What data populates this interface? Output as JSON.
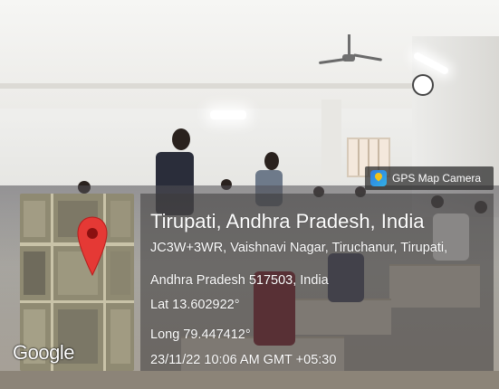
{
  "camera_tag": {
    "icon": "gps-map-camera-icon",
    "label": "GPS Map Camera"
  },
  "map": {
    "logo_text": "Google",
    "pin_icon": "location-pin-icon",
    "pin_color": "#e53935"
  },
  "location": {
    "title": "Tirupati, Andhra Pradesh, India",
    "address_line1": "JC3W+3WR, Vaishnavi Nagar, Tiruchanur, Tirupati,",
    "address_line2": "Andhra Pradesh 517503, India",
    "latitude": "Lat 13.602922°",
    "longitude": "Long 79.447412°",
    "timestamp": "23/11/22 10:06 AM GMT +05:30"
  }
}
